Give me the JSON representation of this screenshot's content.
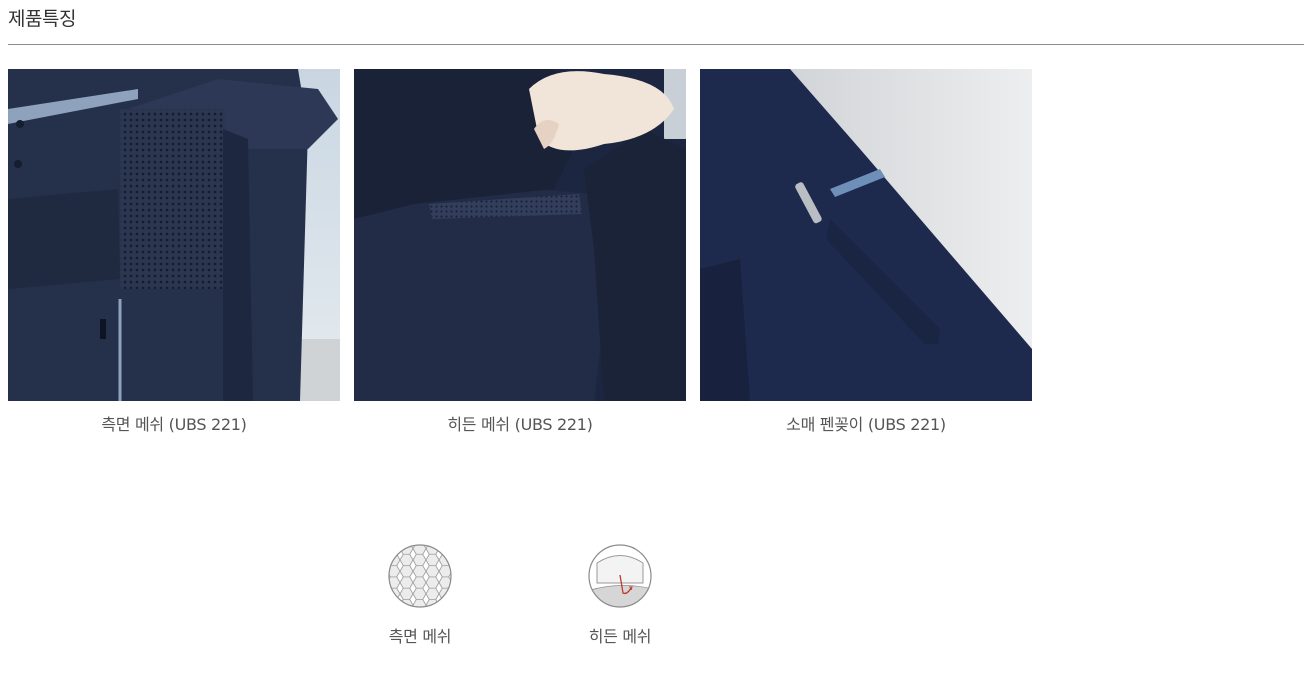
{
  "section": {
    "title": "제품특징"
  },
  "features": [
    {
      "caption": "측면 메쉬 (UBS 221)",
      "photo": "side-mesh-photo"
    },
    {
      "caption": "히든 메쉬 (UBS 221)",
      "photo": "hidden-mesh-photo"
    },
    {
      "caption": "소매 펜꽂이 (UBS 221)",
      "photo": "sleeve-pen-holder-photo"
    }
  ],
  "feature_icons": [
    {
      "label": "측면 메쉬",
      "icon": "hexagon-mesh-icon"
    },
    {
      "label": "히든 메쉬",
      "icon": "hidden-mesh-icon"
    }
  ],
  "colors": {
    "navy": "#1f2a44",
    "navy_dark": "#141c30",
    "mesh": "#2c3855",
    "accent_red": "#c0392b"
  }
}
